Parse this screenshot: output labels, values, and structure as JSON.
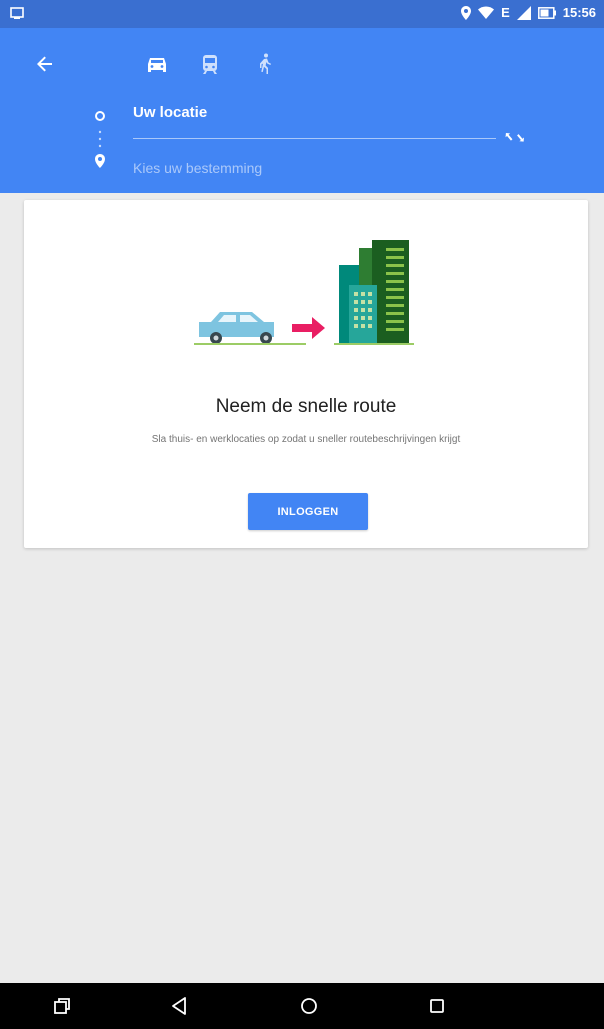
{
  "status_bar": {
    "time": "15:56",
    "network_label": "E",
    "icons": [
      "notification-icon",
      "location-icon",
      "wifi-icon",
      "signal-icon",
      "battery-icon"
    ]
  },
  "app_bar": {
    "icons": [
      "back-arrow-icon",
      "car-icon",
      "transit-icon",
      "walk-icon",
      "swap-icon"
    ],
    "origin": "Uw locatie",
    "destination_placeholder": "Kies uw bestemming"
  },
  "card": {
    "title": "Neem de snelle route",
    "body": "Sla thuis- en werklocaties op zodat u sneller routebeschrijvingen krijgt",
    "button_label": "INLOGGEN"
  },
  "colors": {
    "primary": "#4285f4",
    "status_bar": "#3a6fd0",
    "background": "#ebebeb",
    "arrow_accent": "#e91e63"
  },
  "nav_bar": {
    "icons": [
      "extra-icon",
      "back-icon",
      "home-icon",
      "recents-icon"
    ]
  }
}
